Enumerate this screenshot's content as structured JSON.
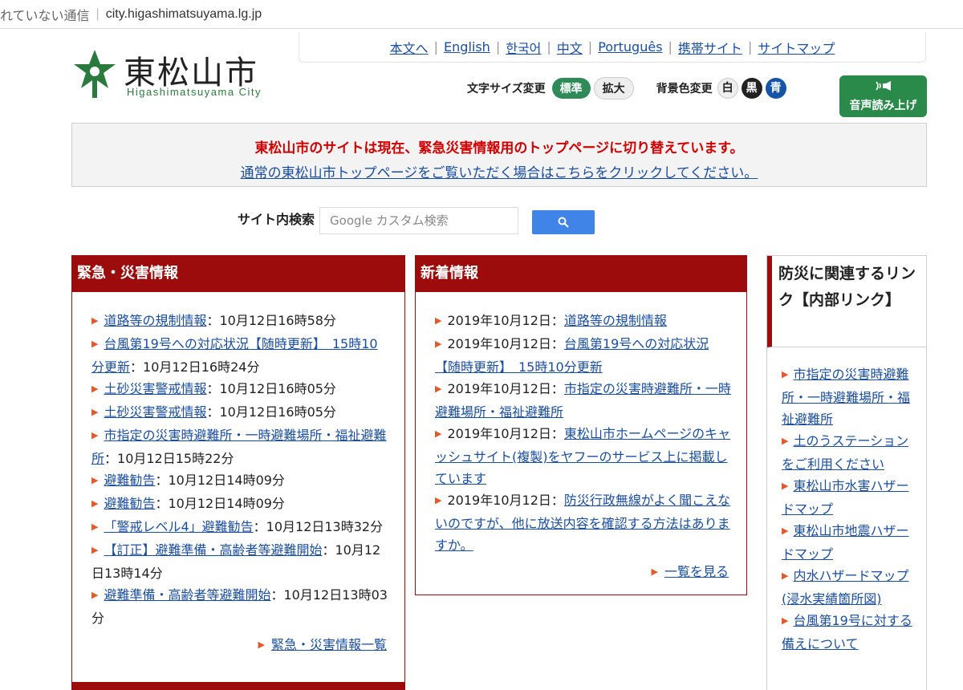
{
  "browser": {
    "security_text": "れていない通信",
    "url": "city.higashimatsuyama.lg.jp"
  },
  "logo": {
    "name_jp": "東松山市",
    "name_en": "Higashimatsuyama City"
  },
  "top_links": [
    "本文へ",
    "English",
    "한국어",
    "中文",
    "Português",
    "携帯サイト",
    "サイトマップ"
  ],
  "tools": {
    "font_size_label": "文字サイズ変更",
    "standard": "標準",
    "enlarge": "拡大",
    "bg_color_label": "背景色変更",
    "white": "白",
    "black": "黒",
    "blue": "青"
  },
  "voice": {
    "icon": "speaker-icon",
    "label": "音声読み上げ"
  },
  "notice": {
    "headline": "東松山市のサイトは現在、緊急災害情報用のトップページに切り替えています。",
    "link": "通常の東松山市トップページをご覧いただく場合はこちらをクリックしてください。"
  },
  "search": {
    "label": "サイト内検索",
    "placeholder": "Google カスタム検索",
    "button_icon": "search-icon"
  },
  "emergency": {
    "title": "緊急・災害情報",
    "items": [
      {
        "link": "道路等の規制情報",
        "date": "：10月12日16時58分"
      },
      {
        "link": "台風第19号への対応状況【随時更新】　15時10分更新",
        "date": "：10月12日16時24分"
      },
      {
        "link": "土砂災害警戒情報",
        "date": "：10月12日16時05分"
      },
      {
        "link": "土砂災害警戒情報",
        "date": "：10月12日16時05分"
      },
      {
        "link": "市指定の災害時避難所・一時避難場所・福祉避難所",
        "date": "：10月12日15時22分"
      },
      {
        "link": "避難勧告",
        "date": "：10月12日14時09分"
      },
      {
        "link": "避難勧告",
        "date": "：10月12日14時09分"
      },
      {
        "link": "「警戒レベル4」避難勧告",
        "date": "：10月12日13時32分"
      },
      {
        "link": "【訂正】避難準備・高齢者等避難開始",
        "date": "：10月12日13時14分"
      },
      {
        "link": "避難準備・高齢者等避難開始",
        "date": "：10月12日13時03分"
      }
    ],
    "more": "緊急・災害情報一覧"
  },
  "news": {
    "title": "新着情報",
    "items": [
      {
        "date": "2019年10月12日：",
        "link": "道路等の規制情報"
      },
      {
        "date": "2019年10月12日：",
        "link": "台風第19号への対応状況【随時更新】　15時10分更新"
      },
      {
        "date": "2019年10月12日：",
        "link": "市指定の災害時避難所・一時避難場所・福祉避難所"
      },
      {
        "date": "2019年10月12日：",
        "link": "東松山市ホームページのキャッシュサイト(複製)をヤフーのサービス上に掲載しています"
      },
      {
        "date": "2019年10月12日：",
        "link": "防災行政無線がよく聞こえないのですが、他に放送内容を確認する方法はありますか。"
      }
    ],
    "more": "一覧を見る"
  },
  "side": {
    "title": "防災に関連するリンク【内部リンク】",
    "items": [
      "市指定の災害時避難所・一時避難場所・福祉避難所",
      "土のうステーションをご利用ください",
      "東松山市水害ハザードマップ",
      "東松山市地震ハザードマップ",
      "内水ハザードマップ(浸水実績箇所図)",
      "台風第19号に対する備えについて"
    ]
  },
  "colors": {
    "accent_red": "#9c0c0c",
    "link_blue": "#1a4ea3",
    "green": "#2a8a4a"
  }
}
